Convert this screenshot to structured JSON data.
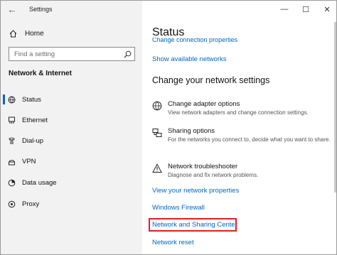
{
  "window": {
    "app_title": "Settings",
    "controls": {
      "minimize": "—",
      "maximize": "☐",
      "close": "✕"
    }
  },
  "sidebar": {
    "home_label": "Home",
    "search_placeholder": "Find a setting",
    "section_title": "Network & Internet",
    "items": [
      {
        "label": "Status",
        "icon": "status-icon",
        "active": true
      },
      {
        "label": "Ethernet",
        "icon": "ethernet-icon",
        "active": false
      },
      {
        "label": "Dial-up",
        "icon": "dialup-icon",
        "active": false
      },
      {
        "label": "VPN",
        "icon": "vpn-icon",
        "active": false
      },
      {
        "label": "Data usage",
        "icon": "data-usage-icon",
        "active": false
      },
      {
        "label": "Proxy",
        "icon": "proxy-icon",
        "active": false
      }
    ]
  },
  "main": {
    "title": "Status",
    "cut_off_link": "Change connection properties",
    "show_networks_link": "Show available networks",
    "subheading": "Change your network settings",
    "options": [
      {
        "title": "Change adapter options",
        "description": "View network adapters and change connection settings.",
        "icon": "adapter-icon"
      },
      {
        "title": "Sharing options",
        "description": "For the networks you connect to, decide what you want to share.",
        "icon": "sharing-icon"
      },
      {
        "title": "Network troubleshooter",
        "description": "Diagnose and fix network problems.",
        "icon": "warning-icon"
      }
    ],
    "links": {
      "properties": "View your network properties",
      "firewall": "Windows Firewall",
      "sharing_center": "Network and Sharing Center",
      "reset": "Network reset"
    },
    "highlight_color": "#e02020",
    "link_color": "#0067c0"
  }
}
